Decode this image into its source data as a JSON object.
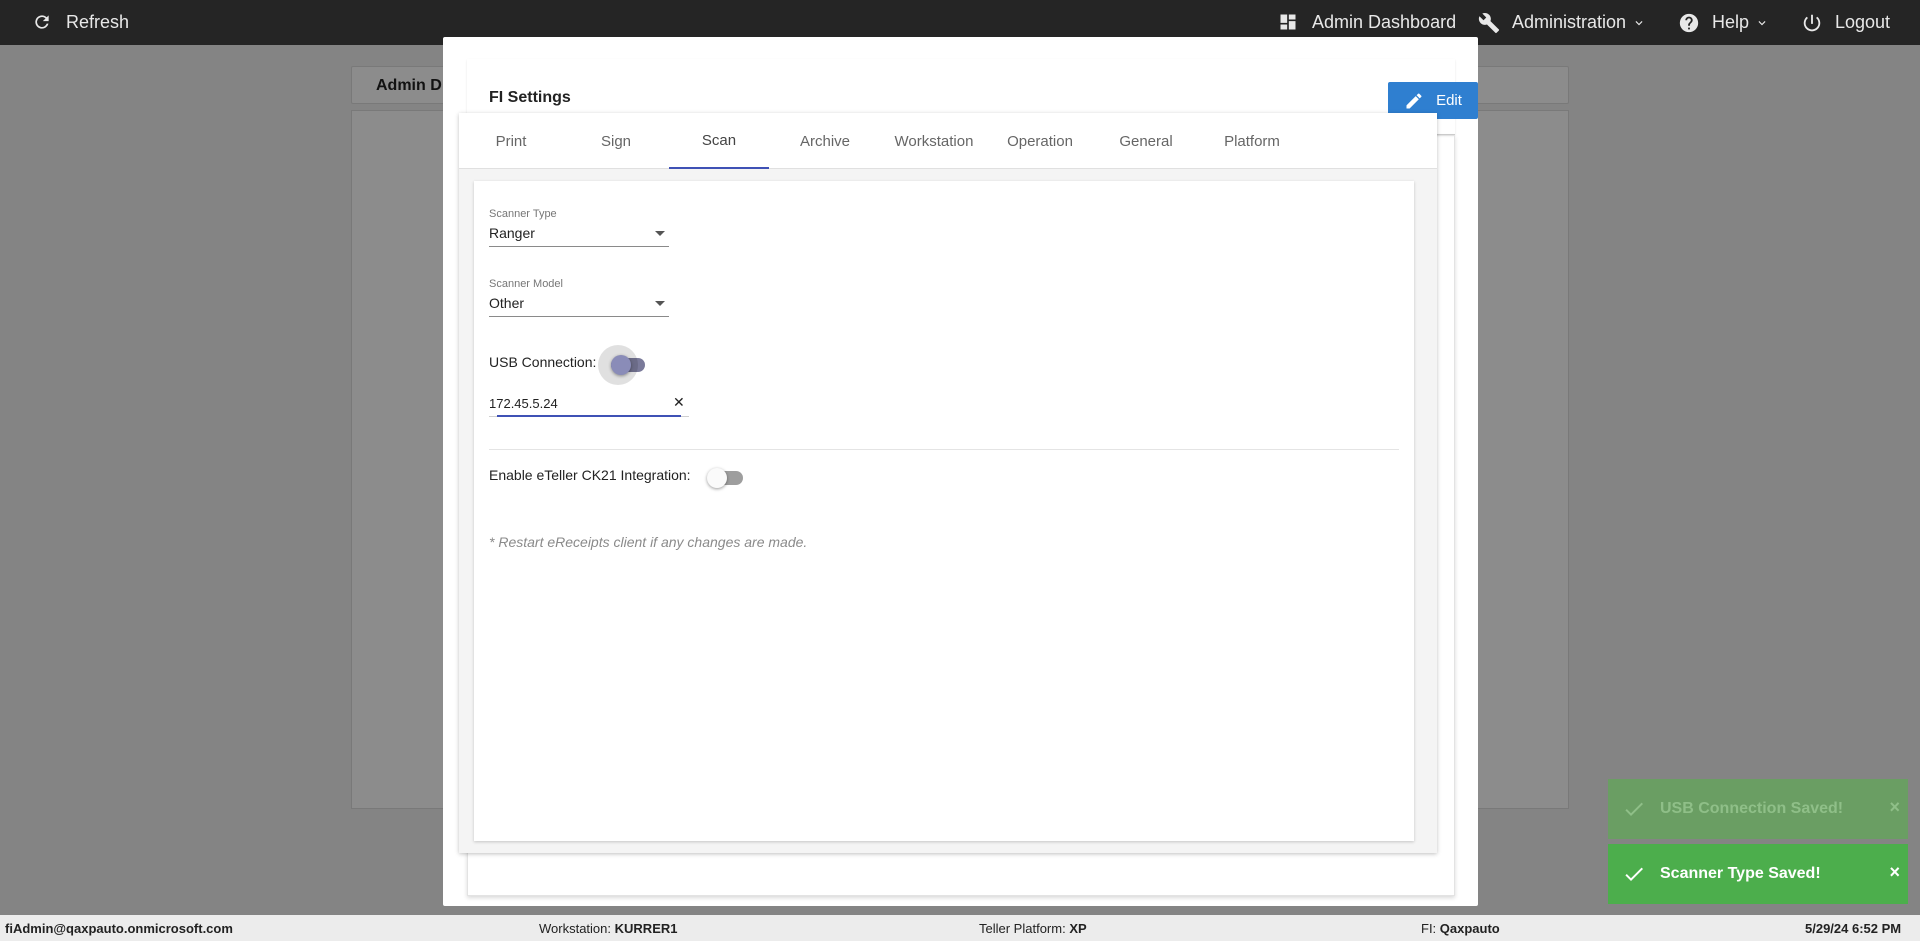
{
  "topbar": {
    "refresh_label": "Refresh",
    "admin_dashboard_label": "Admin Dashboard",
    "administration_label": "Administration",
    "help_label": "Help",
    "logout_label": "Logout"
  },
  "background": {
    "header_title": "Admin D"
  },
  "modal": {
    "title": "FI Settings",
    "edit_label": "Edit",
    "tabs": [
      {
        "label": "Print"
      },
      {
        "label": "Sign"
      },
      {
        "label": "Scan"
      },
      {
        "label": "Archive"
      },
      {
        "label": "Workstation"
      },
      {
        "label": "Operation"
      },
      {
        "label": "General"
      },
      {
        "label": "Platform"
      }
    ],
    "active_tab": "Scan",
    "scan": {
      "scanner_type_label": "Scanner Type",
      "scanner_type_value": "Ranger",
      "scanner_model_label": "Scanner Model",
      "scanner_model_value": "Other",
      "usb_connection_label": "USB Connection:",
      "ip_value": "172.45.5.24",
      "ck21_label": "Enable eTeller CK21 Integration:",
      "note": "* Restart eReceipts client if any changes are made."
    }
  },
  "toasts": [
    {
      "text": "USB Connection Saved!",
      "close": "×"
    },
    {
      "text": "Scanner Type Saved!",
      "close": "×"
    }
  ],
  "footer": {
    "user": "fiAdmin@qaxpauto.onmicrosoft.com",
    "workstation_label": "Workstation:",
    "workstation_value": "KURRER1",
    "teller_platform_label": "Teller Platform:",
    "teller_platform_value": "XP",
    "fi_label": "FI:",
    "fi_value": "Qaxpauto",
    "datetime": "5/29/24 6:52 PM"
  },
  "colors": {
    "accent": "#3f51b5",
    "edit_button": "#2f7fd0",
    "toast_success": "#4cae4c",
    "topbar": "#252525"
  }
}
